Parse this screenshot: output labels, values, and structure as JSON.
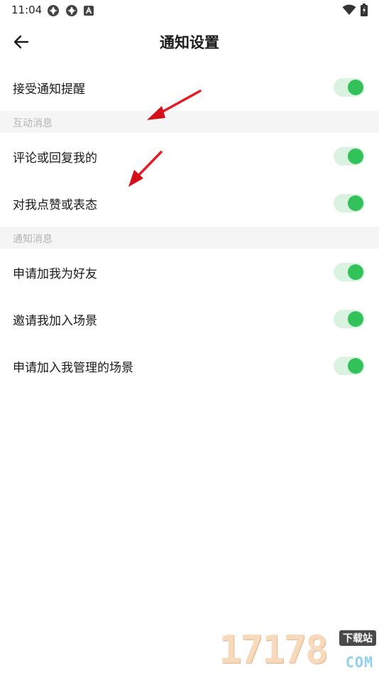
{
  "status_bar": {
    "time": "11:04",
    "left_icons": [
      "sync-icon",
      "sync-icon",
      "app-notification-icon"
    ],
    "right_icons": [
      "wifi-icon",
      "battery-charging-icon"
    ]
  },
  "header": {
    "back_icon": "arrow-left-icon",
    "title": "通知设置"
  },
  "master": {
    "label": "接受通知提醒",
    "on": true
  },
  "sections": [
    {
      "title": "互动消息",
      "items": [
        {
          "label": "评论或回复我的",
          "on": true
        },
        {
          "label": "对我点赞或表态",
          "on": true
        }
      ]
    },
    {
      "title": "通知消息",
      "items": [
        {
          "label": "申请加我为好友",
          "on": true
        },
        {
          "label": "邀请我加入场景",
          "on": true
        },
        {
          "label": "申请加入我管理的场景",
          "on": true
        }
      ]
    }
  ],
  "colors": {
    "toggle_track": "#daf3e0",
    "toggle_knob": "#33c15a",
    "section_bg": "#f5f5f5",
    "section_text": "#b3b3b3",
    "annotation_arrow": "#e0141e"
  },
  "watermark": {
    "digits": "17178",
    "tag": "下载站",
    "suffix": "COM"
  }
}
